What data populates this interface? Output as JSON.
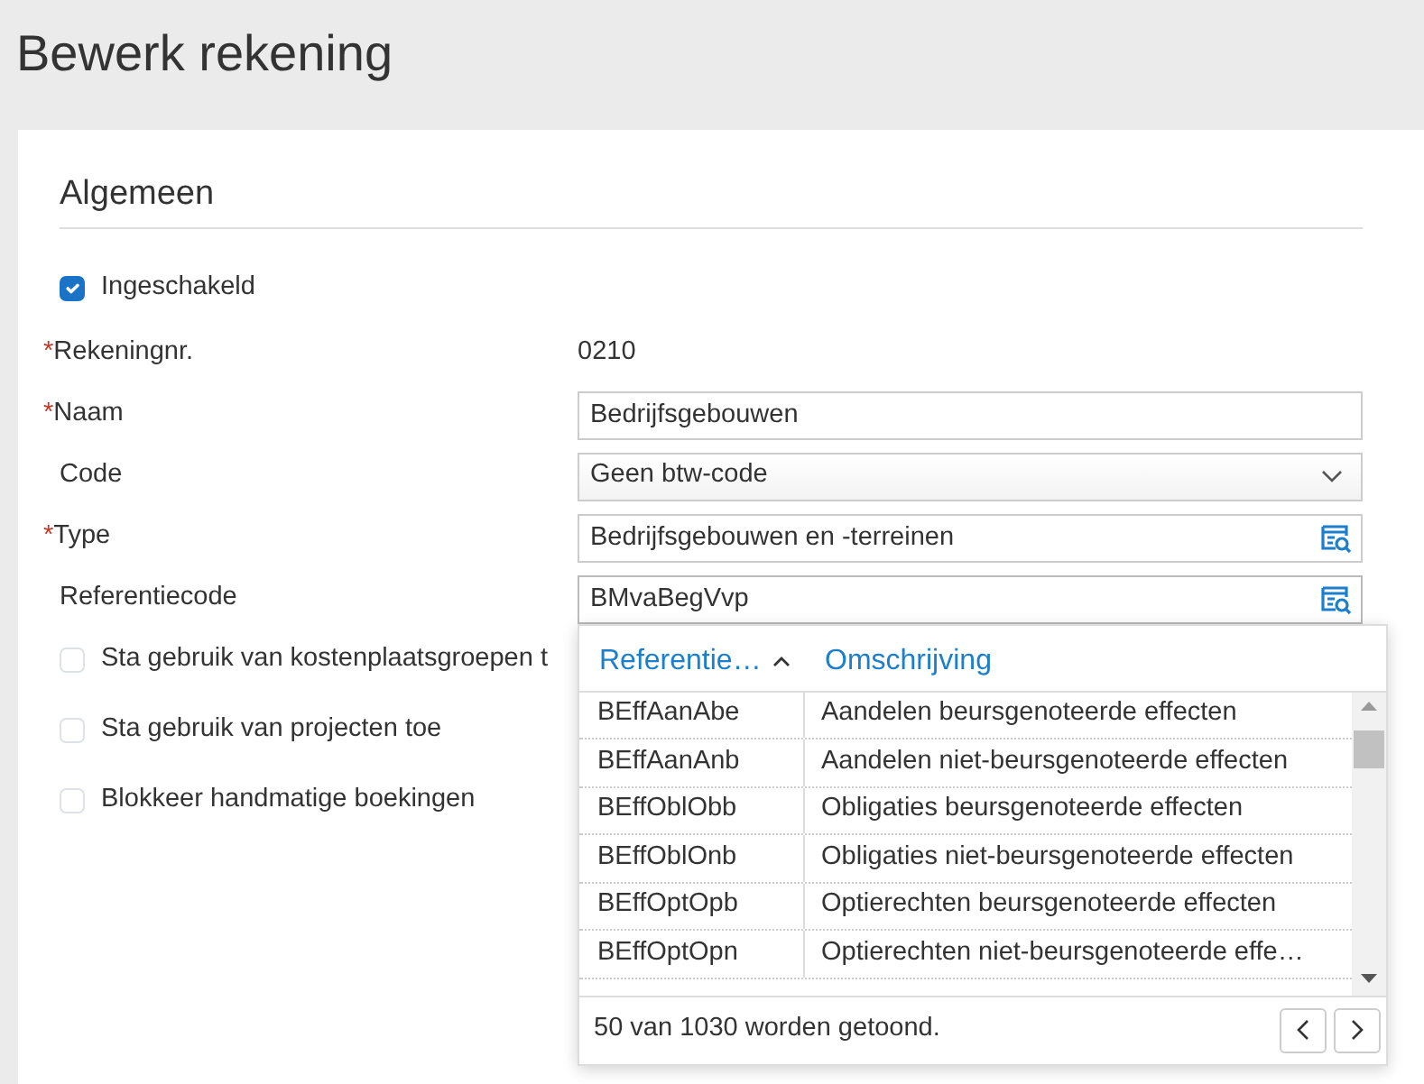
{
  "page_title": "Bewerk rekening",
  "section": "Algemeen",
  "required_mark": "*",
  "fields": [
    {
      "kind": "checkbox",
      "label": "Ingeschakeld",
      "checked": true
    },
    {
      "kind": "static",
      "label": "Rekeningnr.",
      "required": true,
      "value": "0210"
    },
    {
      "kind": "text",
      "label": "Naam",
      "required": true,
      "value": "Bedrijfsgebouwen"
    },
    {
      "kind": "select",
      "label": "Code",
      "required": false,
      "value": "Geen btw-code"
    },
    {
      "kind": "lookup",
      "label": "Type",
      "required": true,
      "value": "Bedrijfsgebouwen en -terreinen"
    },
    {
      "kind": "lookup",
      "label": "Referentiecode",
      "required": false,
      "value": "BMvaBegVvp",
      "popup_open": true
    },
    {
      "kind": "checkbox",
      "label": "Sta gebruik van kostenplaatsgroepen t",
      "checked": false
    },
    {
      "kind": "checkbox",
      "label": "Sta gebruik van projecten toe",
      "checked": false
    },
    {
      "kind": "checkbox",
      "label": "Blokkeer handmatige boekingen",
      "checked": false
    }
  ],
  "lookup_popup": {
    "columns": [
      {
        "label": "Referentie…",
        "sorted_ascending": true
      },
      {
        "label": "Omschrijving",
        "sorted_ascending": false
      }
    ],
    "rows": [
      {
        "code": "BEffAanAbe",
        "description": "Aandelen beursgenoteerde effecten"
      },
      {
        "code": "BEffAanAnb",
        "description": "Aandelen niet-beursgenoteerde effecten"
      },
      {
        "code": "BEffOblObb",
        "description": "Obligaties beursgenoteerde effecten"
      },
      {
        "code": "BEffOblOnb",
        "description": "Obligaties niet-beursgenoteerde effecten"
      },
      {
        "code": "BEffOptOpb",
        "description": "Optierechten beursgenoteerde effecten"
      },
      {
        "code": "BEffOptOpn",
        "description": "Optierechten niet-beursgenoteerde effe…"
      }
    ],
    "footer": "50 van 1030 worden getoond."
  }
}
